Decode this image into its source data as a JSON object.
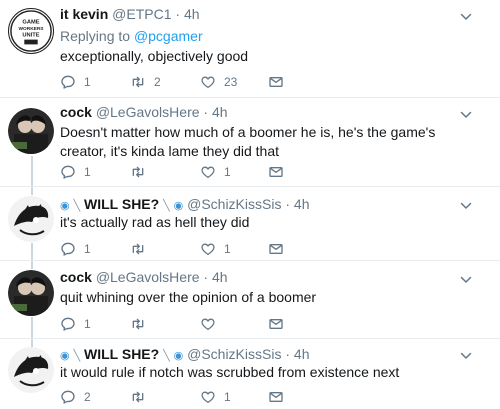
{
  "tweets": [
    {
      "name": "it kevin",
      "handle": "@ETPC1",
      "time": "4h",
      "replying_prefix": "Replying to ",
      "replying_to": "@pcgamer",
      "text": "exceptionally, objectively good",
      "replies": "1",
      "retweets": "2",
      "likes": "23",
      "avatar_text": [
        "GAME",
        "WORKERS",
        "UNITE"
      ]
    },
    {
      "name": "cock",
      "handle": "@LeGavolsHere",
      "time": "4h",
      "text": "Doesn't matter how much of a boomer he is, he's the game's creator, it's kinda lame they did that",
      "replies": "1",
      "retweets": "",
      "likes": "1"
    },
    {
      "name": "WILL SHE?",
      "handle": "@SchizKissSis",
      "time": "4h",
      "text": "it's actually rad as hell they did",
      "replies": "1",
      "retweets": "",
      "likes": "1"
    },
    {
      "name": "cock",
      "handle": "@LeGavolsHere",
      "time": "4h",
      "text": "quit whining over the opinion of a boomer",
      "replies": "1",
      "retweets": "",
      "likes": ""
    },
    {
      "name": "WILL SHE?",
      "handle": "@SchizKissSis",
      "time": "4h",
      "text": "it would rule if notch was scrubbed from existence next",
      "replies": "2",
      "retweets": "",
      "likes": "1"
    }
  ],
  "sep": " · ",
  "icons": {
    "reply": "reply-icon",
    "retweet": "retweet-icon",
    "like": "heart-icon",
    "dm": "direct-message-icon",
    "caret": "chevron-down-icon"
  },
  "colors": {
    "link": "#1da1f2",
    "muted": "#657786",
    "divider": "#e6ecf0"
  }
}
